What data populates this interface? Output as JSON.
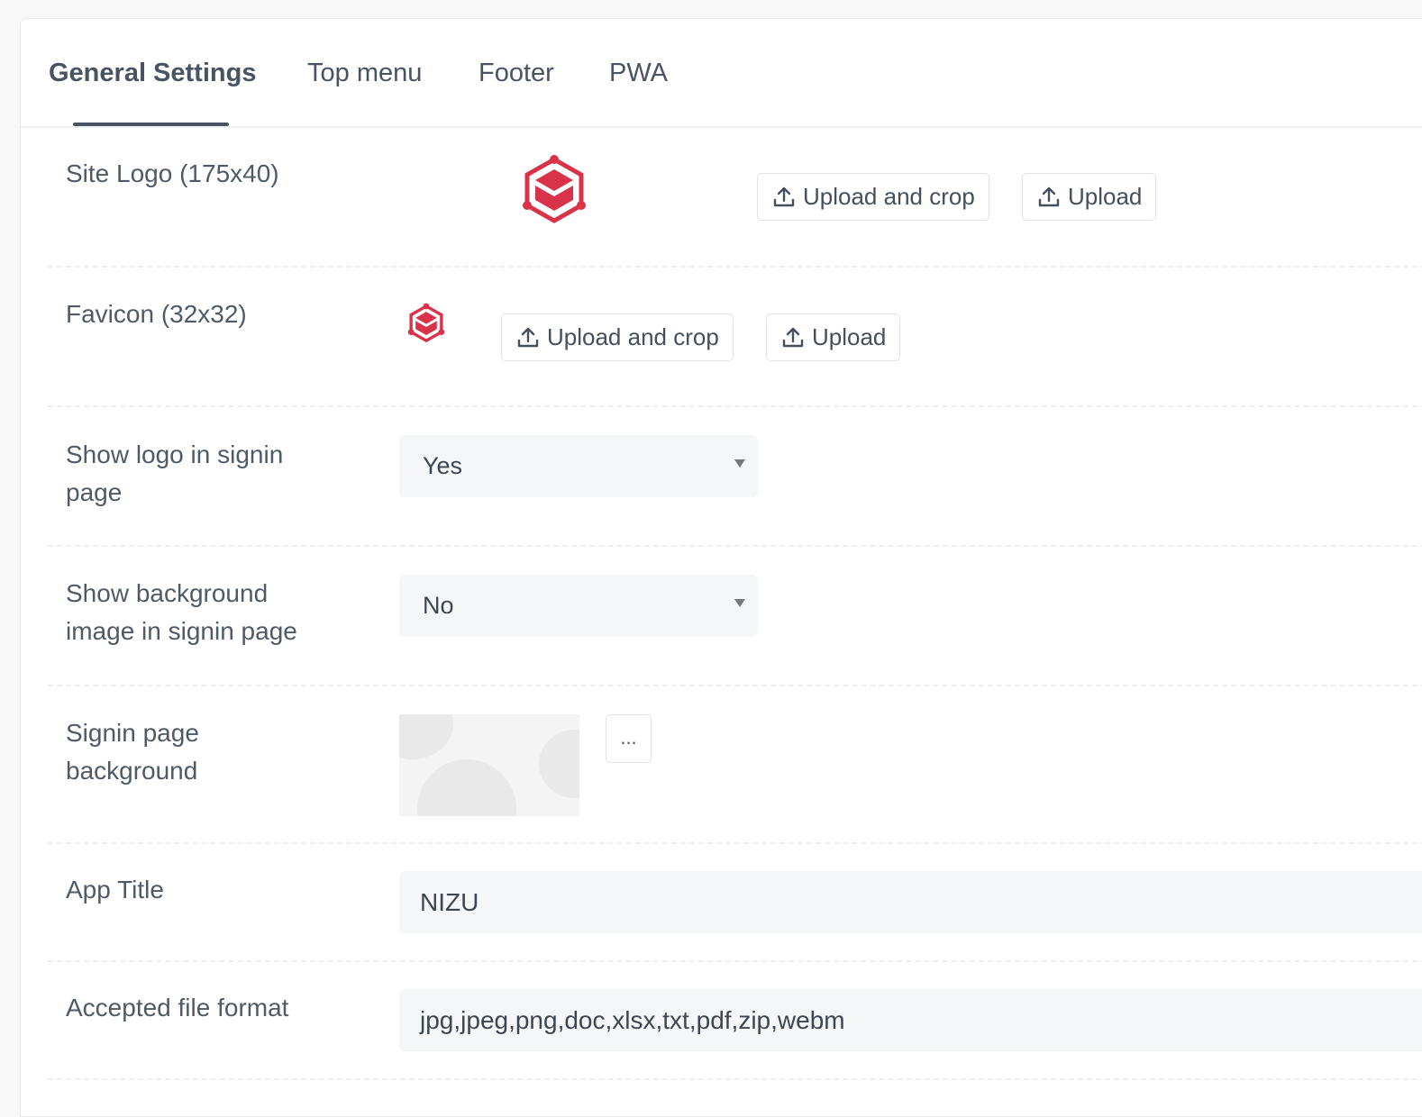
{
  "tabs": [
    {
      "label": "General Settings",
      "active": true
    },
    {
      "label": "Top menu",
      "active": false
    },
    {
      "label": "Footer",
      "active": false
    },
    {
      "label": "PWA",
      "active": false
    }
  ],
  "colors": {
    "logo_red": "#d93349",
    "tab_active": "#4a5361",
    "field_bg": "#f5f6f7"
  },
  "site_logo": {
    "label": "Site Logo (175x40)",
    "icon": "hexagon-logo-icon",
    "upload_crop_label": "Upload and crop",
    "upload_label": "Upload"
  },
  "favicon": {
    "label": "Favicon (32x32)",
    "icon": "hexagon-logo-icon",
    "upload_crop_label": "Upload and crop",
    "upload_label": "Upload"
  },
  "show_logo": {
    "label": "Show logo in signin page",
    "value": "Yes"
  },
  "show_background": {
    "label": "Show background image in signin page",
    "value": "No"
  },
  "signin_background": {
    "label": "Signin page background",
    "more_label": "..."
  },
  "app_title": {
    "label": "App Title",
    "value": "NIZU"
  },
  "accepted_formats": {
    "label": "Accepted file format",
    "value": "jpg,jpeg,png,doc,xlsx,txt,pdf,zip,webm"
  }
}
